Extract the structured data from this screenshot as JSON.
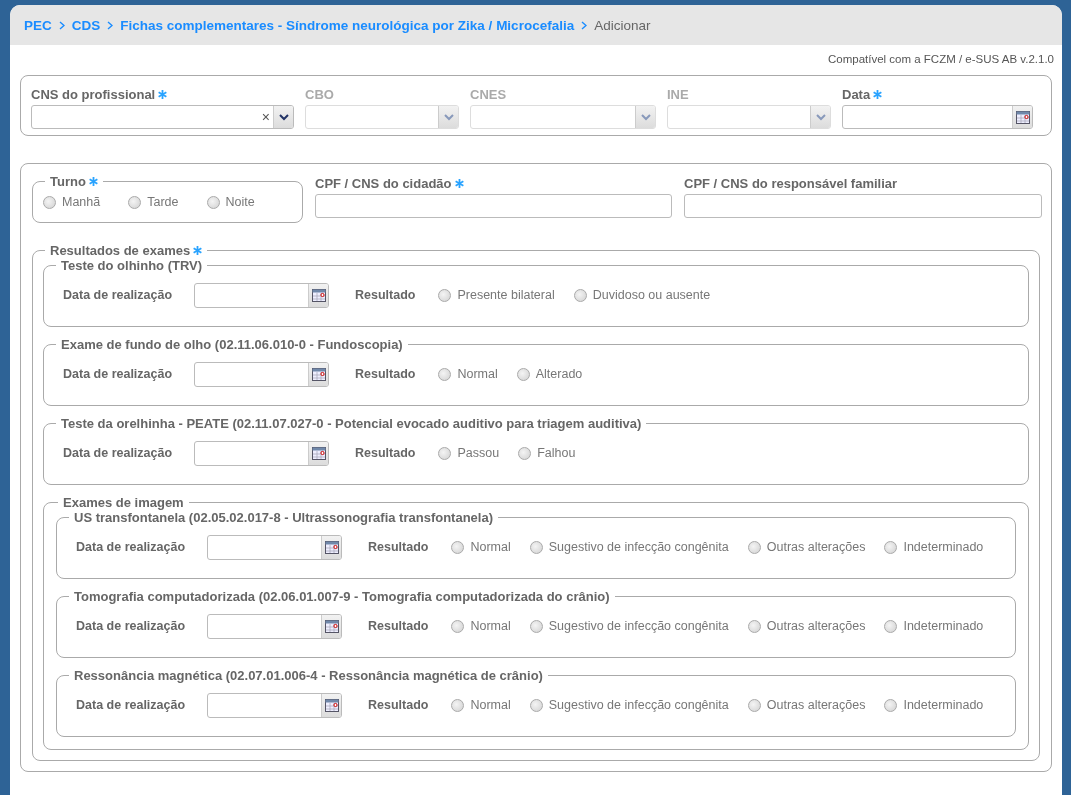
{
  "breadcrumb": [
    {
      "label": "PEC",
      "current": false
    },
    {
      "label": "CDS",
      "current": false
    },
    {
      "label": "Fichas complementares - Síndrome neurológica por Zika / Microcefalia",
      "current": false
    },
    {
      "label": "Adicionar",
      "current": true
    }
  ],
  "version_note": "Compatível com a FCZM / e-SUS AB v.2.1.0",
  "professional_fields": [
    {
      "label": "CNS do profissional",
      "required": true,
      "kind": "combo",
      "disabled": false,
      "clear": "×"
    },
    {
      "label": "CBO",
      "required": false,
      "kind": "select",
      "disabled": true
    },
    {
      "label": "CNES",
      "required": false,
      "kind": "select",
      "disabled": true
    },
    {
      "label": "INE",
      "required": false,
      "kind": "select",
      "disabled": true
    },
    {
      "label": "Data",
      "required": true,
      "kind": "date",
      "disabled": false
    }
  ],
  "turno": {
    "label": "Turno",
    "required": true,
    "options": [
      {
        "label": "Manhã",
        "selected": false
      },
      {
        "label": "Tarde",
        "selected": false
      },
      {
        "label": "Noite",
        "selected": false
      }
    ]
  },
  "citizen_fields": [
    {
      "label": "CPF / CNS do cidadão",
      "required": true
    },
    {
      "label": "CPF / CNS do responsável familiar",
      "required": false
    }
  ],
  "results": {
    "label": "Resultados de exames",
    "required": true,
    "exams": [
      {
        "title": "Teste do olhinho (TRV)",
        "date_label": "Data de realização",
        "result_label": "Resultado",
        "options": [
          {
            "label": "Presente bilateral",
            "selected": false
          },
          {
            "label": "Duvidoso ou ausente",
            "selected": false
          }
        ]
      },
      {
        "title": "Exame de fundo de olho (02.11.06.010-0 - Fundoscopia)",
        "date_label": "Data de realização",
        "result_label": "Resultado",
        "options": [
          {
            "label": "Normal",
            "selected": false
          },
          {
            "label": "Alterado",
            "selected": false
          }
        ]
      },
      {
        "title": "Teste da orelhinha - PEATE (02.11.07.027-0 - Potencial evocado auditivo para triagem auditiva)",
        "date_label": "Data de realização",
        "result_label": "Resultado",
        "options": [
          {
            "label": "Passou",
            "selected": false
          },
          {
            "label": "Falhou",
            "selected": false
          }
        ]
      }
    ],
    "imaging": {
      "title": "Exames de imagem",
      "exams": [
        {
          "title": "US transfontanela (02.05.02.017-8 - Ultrassonografia transfontanela)",
          "date_label": "Data de realização",
          "result_label": "Resultado",
          "options": [
            {
              "label": "Normal",
              "selected": false
            },
            {
              "label": "Sugestivo de infecção congênita",
              "selected": false
            },
            {
              "label": "Outras alterações",
              "selected": false
            },
            {
              "label": "Indeterminado",
              "selected": false
            }
          ]
        },
        {
          "title": "Tomografia computadorizada (02.06.01.007-9 - Tomografia computadorizada do crânio)",
          "date_label": "Data de realização",
          "result_label": "Resultado",
          "options": [
            {
              "label": "Normal",
              "selected": false
            },
            {
              "label": "Sugestivo de infecção congênita",
              "selected": false
            },
            {
              "label": "Outras alterações",
              "selected": false
            },
            {
              "label": "Indeterminado",
              "selected": false
            }
          ]
        },
        {
          "title": "Ressonância magnética (02.07.01.006-4 - Ressonância magnética de crânio)",
          "date_label": "Data de realização",
          "result_label": "Resultado",
          "options": [
            {
              "label": "Normal",
              "selected": false
            },
            {
              "label": "Sugestivo de infecção congênita",
              "selected": false
            },
            {
              "label": "Outras alterações",
              "selected": false
            },
            {
              "label": "Indeterminado",
              "selected": false
            }
          ]
        }
      ]
    }
  }
}
